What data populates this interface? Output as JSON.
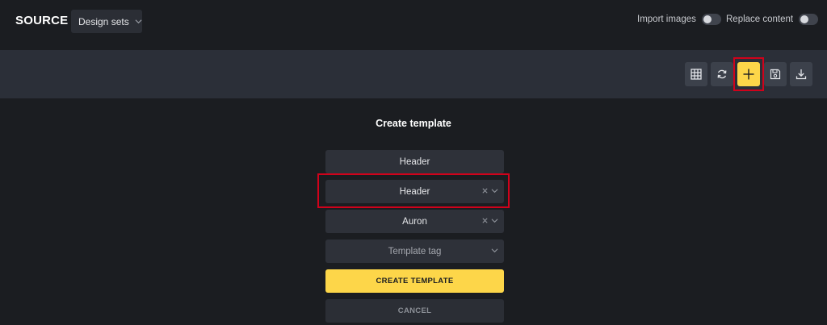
{
  "header": {
    "brand": "SOURCE",
    "design_sets_label": "Design sets",
    "import_images_label": "Import images",
    "replace_content_label": "Replace content"
  },
  "toolbar": {
    "buttons": [
      {
        "name": "grid-button",
        "icon": "grid-icon"
      },
      {
        "name": "refresh-button",
        "icon": "refresh-icon"
      },
      {
        "name": "add-template-button",
        "icon": "plus-icon",
        "highlighted": true
      },
      {
        "name": "save-button",
        "icon": "floppy-disk-icon"
      },
      {
        "name": "download-button",
        "icon": "download-icon"
      }
    ]
  },
  "form": {
    "title": "Create template",
    "name_value": "Header",
    "type_value": "Header",
    "brand_value": "Auron",
    "tag_placeholder": "Template tag",
    "create_label": "CREATE TEMPLATE",
    "cancel_label": "CANCEL"
  },
  "colors": {
    "background": "#1b1d21",
    "toolbar": "#2b2f38",
    "field": "#2e3139",
    "accent": "#fdd649",
    "highlight": "#d0021b"
  }
}
